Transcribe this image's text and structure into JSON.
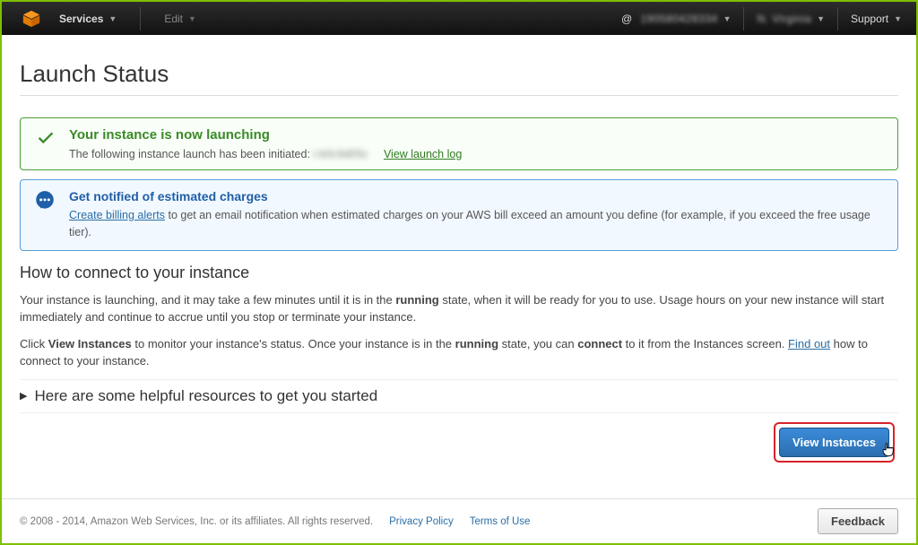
{
  "topbar": {
    "services": "Services",
    "edit": "Edit",
    "account_blur": "190580428334",
    "region_blur": "N. Virginia",
    "support": "Support"
  },
  "page": {
    "title": "Launch Status"
  },
  "success_panel": {
    "title": "Your instance is now launching",
    "body_prefix": "The following instance launch has been initiated: ",
    "instance_id_blur": "i-b0c9d05c",
    "view_log": "View launch log"
  },
  "info_panel": {
    "title": "Get notified of estimated charges",
    "link": "Create billing alerts",
    "body_rest": " to get an email notification when estimated charges on your AWS bill exceed an amount you define (for example, if you exceed the free usage tier)."
  },
  "connect": {
    "heading": "How to connect to your instance",
    "p1_a": "Your instance is launching, and it may take a few minutes until it is in the ",
    "p1_b": "running",
    "p1_c": " state, when it will be ready for you to use. Usage hours on your new instance will start immediately and continue to accrue until you stop or terminate your instance.",
    "p2_a": "Click ",
    "p2_b": "View Instances",
    "p2_c": " to monitor your instance's status. Once your instance is in the ",
    "p2_d": "running",
    "p2_e": " state, you can ",
    "p2_f": "connect",
    "p2_g": " to it from the Instances screen. ",
    "p2_link": "Find out",
    "p2_h": " how to connect to your instance."
  },
  "resources": {
    "heading": "Here are some helpful resources to get you started"
  },
  "actions": {
    "view_instances": "View Instances"
  },
  "footer": {
    "copyright": "© 2008 - 2014, Amazon Web Services, Inc. or its affiliates. All rights reserved.",
    "privacy": "Privacy Policy",
    "terms": "Terms of Use",
    "feedback": "Feedback"
  }
}
